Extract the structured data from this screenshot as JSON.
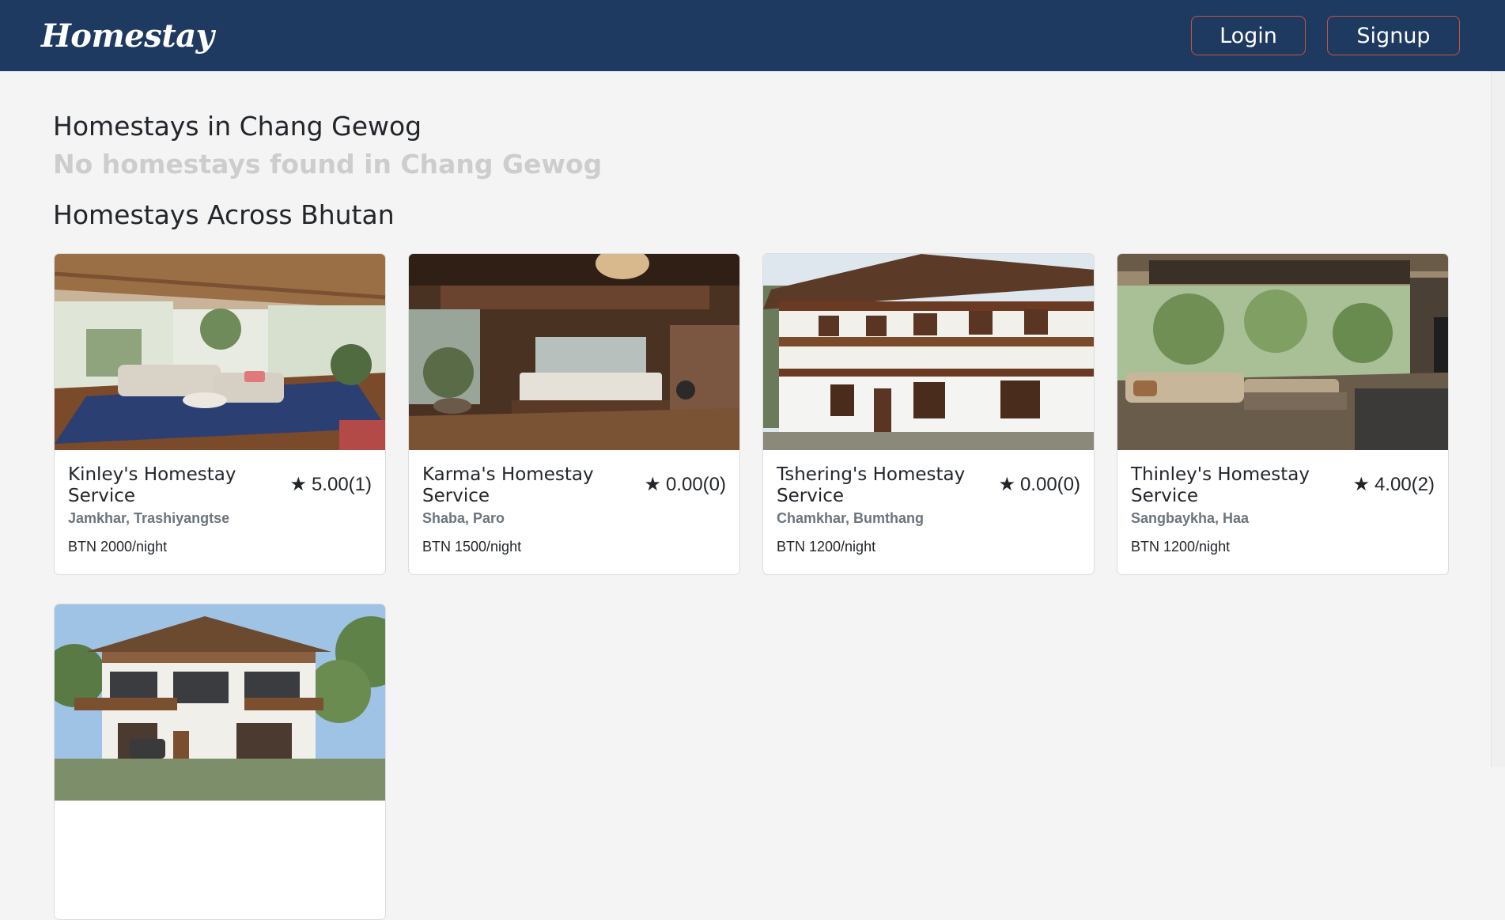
{
  "brand": {
    "logo": "Homestay"
  },
  "nav": {
    "login_label": "Login",
    "signup_label": "Signup"
  },
  "local_section": {
    "title": "Homestays in Chang Gewog",
    "empty_message": "No homestays found in Chang Gewog"
  },
  "all_section": {
    "title": "Homestays Across Bhutan"
  },
  "icons": {
    "rating": "star-icon"
  },
  "colors": {
    "header_bg": "#1f3a60",
    "button_border": "#c8553d",
    "page_bg": "#f4f4f4"
  },
  "cards": [
    {
      "name": "Kinley's Homestay Service",
      "rating": "5.00(1)",
      "location": "Jamkhar, Trashiyangtse",
      "price": "BTN 2000/night"
    },
    {
      "name": "Karma's Homestay Service",
      "rating": "0.00(0)",
      "location": "Shaba, Paro",
      "price": "BTN 1500/night"
    },
    {
      "name": "Tshering's Homestay Service",
      "rating": "0.00(0)",
      "location": "Chamkhar, Bumthang",
      "price": "BTN 1200/night"
    },
    {
      "name": "Thinley's Homestay Service",
      "rating": "4.00(2)",
      "location": "Sangbaykha, Haa",
      "price": "BTN 1200/night"
    }
  ]
}
